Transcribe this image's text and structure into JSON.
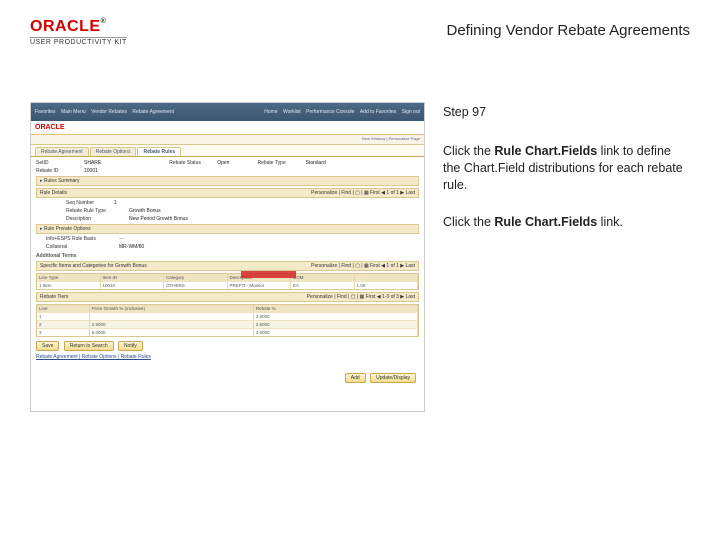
{
  "logo": {
    "brand": "ORACLE",
    "reg": "®",
    "sub": "USER PRODUCTIVITY KIT"
  },
  "page_title": "Defining Vendor Rebate Agreements",
  "step_label": "Step 97",
  "instruction_1a": "Click the ",
  "instruction_1b": "Rule Chart.Fields",
  "instruction_1c": " link to define the Chart.Field distributions for each rebate rule.",
  "instruction_2a": "Click the ",
  "instruction_2b": "Rule Chart.Fields",
  "instruction_2c": " link.",
  "ss": {
    "top_left": {
      "a": "Favorites",
      "b": "Main Menu",
      "c": "Vendor Rebates",
      "d": "Rebate Agreement"
    },
    "top_right": {
      "a": "Home",
      "b": "Worklist",
      "c": "Performance Console",
      "d": "Add to Favorites",
      "e": "Sign out"
    },
    "oracle": "ORACLE",
    "subnav": "New Window | Personalize Page",
    "tabs": {
      "t1": "Rebate Agreement",
      "t2": "Rebate Options",
      "t3": "Rebate Rules"
    },
    "setid_label": "SetID",
    "setid_val": "SHARE",
    "rebateid_label": "Rebate ID",
    "rebateid_val": "10001",
    "status_label": "Rebate Status",
    "status_val": "Open",
    "type_label": "Rebate Type",
    "type_val": "Standard",
    "rules_summary": "Rules Summary",
    "ruledetails": "Rule Details",
    "seq_label": "Seq Number",
    "seq_val": "1",
    "rtype_label": "Rebate Rule Type",
    "rtype_val": "Growth Bonus",
    "desc_label": "Description",
    "desc_val": "New Period Growth Bonus",
    "ruleprorate": "Rule Prorate Options",
    "info_label": "Info+ESPS Rule Basis",
    "coll_label": "Collateral",
    "coll_val": "MR-WM/80",
    "addlterms": "Additional Terms",
    "termline": "Specific Items and Categories for Growth Bonus",
    "paging1": "Personalize | Find | ▢ | ▦   First ◀ 1 of 1 ▶ Last",
    "grid1": {
      "h1": "Line Type",
      "h2": "Item ID",
      "h3": "Category",
      "h4": "Description",
      "h5": "UOM",
      "h6": "",
      "r1": {
        "c1": "1 Item",
        "c2": "10010",
        "c3": "OTHERS",
        "c4": "PREFIT - Monitor",
        "c5": "EA",
        "c6": "1.00"
      }
    },
    "tiers_title": "Rebate Tiers",
    "paging2": "Personalize | Find | ▢ | ▦   First ◀ 1-3 of 3 ▶ Last",
    "grid2": {
      "h1": "Line",
      "h2": "From Growth % (Inclusive)",
      "h3": "Rebate %",
      "r1": {
        "c1": "1",
        "c2": "",
        "c3": "2.0000"
      },
      "r2": {
        "c1": "2",
        "c2": "2.5000",
        "c3": "2.5000"
      },
      "r3": {
        "c1": "3",
        "c2": "5.0000",
        "c3": "3.0000"
      }
    },
    "btn_save": "Save",
    "btn_return": "Return to Search",
    "btn_notify": "Notify",
    "btn_add": "Add",
    "btn_update": "Update/Display",
    "footer_link": "Rebate Agreement | Rebate Options | Rebate Rules"
  }
}
